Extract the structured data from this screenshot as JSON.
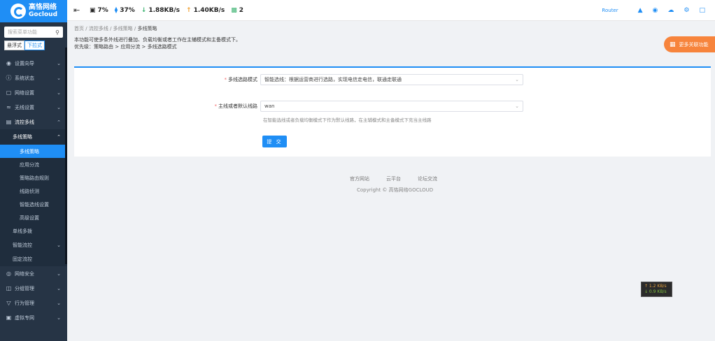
{
  "brand": {
    "name_cn": "高恪网络",
    "name_en": "Gocloud"
  },
  "sidebar": {
    "search_placeholder": "搜索菜单功能",
    "mode": {
      "float": "悬浮式",
      "dropdown": "下拉式"
    },
    "items": [
      {
        "label": "设置向导",
        "icon": "compass-icon"
      },
      {
        "label": "系统状态",
        "icon": "info-icon"
      },
      {
        "label": "网络设置",
        "icon": "monitor-icon"
      },
      {
        "label": "无线设置",
        "icon": "wifi-icon"
      },
      {
        "label": "流控多线",
        "icon": "flow-icon"
      }
    ],
    "sub_open": "多线策略",
    "leaves": [
      "多线策略",
      "应用分流",
      "策略路由规则",
      "线路侦测",
      "智能选线设置",
      "高级设置"
    ],
    "subs": [
      "单线多拨",
      "智能流控",
      "固定流控"
    ],
    "items_bottom": [
      {
        "label": "网络安全",
        "icon": "shield-icon"
      },
      {
        "label": "分组管理",
        "icon": "group-icon"
      },
      {
        "label": "行为管理",
        "icon": "filter-icon"
      },
      {
        "label": "虚拟专网",
        "icon": "lock-icon"
      }
    ]
  },
  "topbar": {
    "cpu": "7%",
    "mem": "37%",
    "down": "1.88KB/s",
    "up": "1.40KB/s",
    "devices": "2",
    "router": "Router"
  },
  "breadcrumb": [
    "首页",
    "流控多线",
    "多线策略",
    "多线策略"
  ],
  "desc_line1": "本功能可使多条外线进行叠加、负载均衡或者工作在主辅模式和主备模式下。",
  "desc_line2": "优先级：策略路由 > 应用分流 > 多线选路模式",
  "promo": "更多关联功能",
  "form": {
    "mode_label": "多线选路模式",
    "mode_value": "智能选线：根据运营商进行选路，实现电信走电信，联通走联通",
    "line_label": "主线或者默认线路",
    "line_value": "wan",
    "hint": "在智能选线或者负载均衡模式下作为默认线路，在主辅模式和主备模式下充当主线路",
    "submit": "提 交"
  },
  "footer": {
    "links": [
      "官方网站",
      "云平台",
      "论坛交流"
    ],
    "copyright": "Copyright © 高恪网络GOCLOUD"
  },
  "speed": {
    "up": "↑ 1.2 KB/s",
    "down": "↓ 0.9 KB/s"
  },
  "colors": {
    "accent": "#1f8ef5",
    "sidebar": "#263445",
    "promo": "#f7843c"
  }
}
